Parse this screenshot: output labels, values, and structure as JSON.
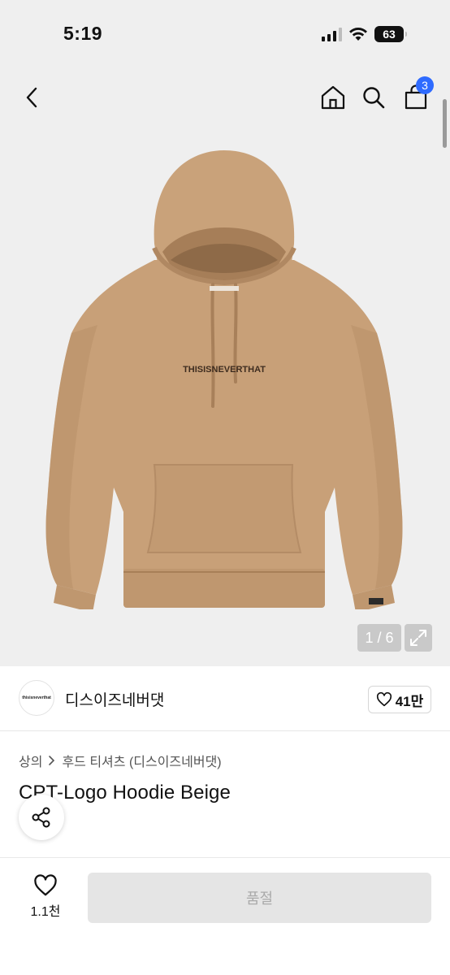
{
  "status_bar": {
    "time": "5:19",
    "battery": "63"
  },
  "nav": {
    "back_icon": "chevron-left-icon",
    "home_icon": "home-icon",
    "search_icon": "search-icon",
    "cart_icon": "shopping-bag-icon",
    "cart_badge": "3"
  },
  "gallery": {
    "product_print": "THISISNEVERTHAT",
    "counter": "1 / 6",
    "expand_icon": "expand-icon"
  },
  "brand": {
    "logo_text": "thisisneverthat",
    "name": "디스이즈네버댓",
    "like_count": "41만"
  },
  "breadcrumb": {
    "items": [
      "상의",
      "후드 티셔츠 (디스이즈네버댓)"
    ]
  },
  "product": {
    "title": "CPT-Logo Hoodie Beige"
  },
  "bottom_bar": {
    "wish_count": "1.1천",
    "buy_label": "품절"
  },
  "colors": {
    "accent": "#2f6bff",
    "hoodie": "#c9a27a",
    "image_bg": "#efefef",
    "disabled_button": "#e5e5e5"
  }
}
